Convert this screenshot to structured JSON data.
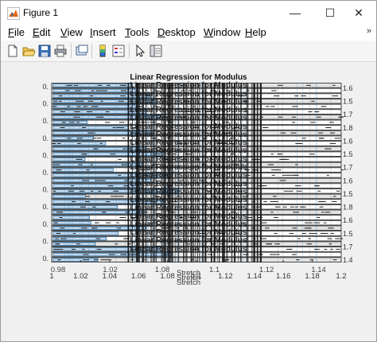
{
  "window": {
    "title": "Figure 1",
    "minimize_glyph": "—",
    "maximize_glyph": "☐",
    "close_glyph": "✕"
  },
  "menubar": {
    "items": [
      {
        "label": "File"
      },
      {
        "label": "Edit"
      },
      {
        "label": "View"
      },
      {
        "label": "Insert"
      },
      {
        "label": "Tools"
      },
      {
        "label": "Desktop"
      },
      {
        "label": "Window"
      },
      {
        "label": "Help"
      }
    ],
    "overflow_glyph": "»"
  },
  "toolbar": {
    "buttons": [
      {
        "icon": "new-figure-icon"
      },
      {
        "icon": "open-file-icon"
      },
      {
        "icon": "save-icon"
      },
      {
        "icon": "print-icon"
      },
      {
        "icon": "link-plot-icon"
      },
      {
        "icon": "insert-colorbar-icon"
      },
      {
        "icon": "insert-legend-icon"
      },
      {
        "icon": "pointer-icon"
      },
      {
        "icon": "property-inspector-icon"
      }
    ]
  },
  "colors": {
    "bar_fill": "#c6dbef",
    "bar_edge": "#1f1f1f",
    "bar_highlight": "#2f6f9f"
  },
  "chart_data": {
    "type": "bar",
    "title": "Linear Regression for Modulus",
    "xlabel": "Stretch",
    "ylabel": "",
    "x_ticks": [
      "1",
      "1.02",
      "1.04",
      "1.06",
      "1.08",
      "1.1",
      "1.12",
      "1.14",
      "1.16",
      "1.18",
      "1.2"
    ],
    "x_ticks_secondary": [
      "0.98",
      "1.02",
      "1.08",
      "1.1",
      "1.12",
      "1.14"
    ],
    "left_tick_labels": [
      "0.",
      "0.",
      "0.",
      "0.",
      "0.",
      "0.",
      "0.",
      "0.",
      "0.",
      "0.",
      "0."
    ],
    "right_tick_labels": [
      "1.6",
      "1.5",
      "1.7",
      "1.8",
      "1.6",
      "1.5",
      "1.7",
      "1.6",
      "1.5",
      "1.8",
      "1.6",
      "1.5",
      "1.7",
      "1.4"
    ],
    "grid": false,
    "legend": "none",
    "note": "Heavily overlapping stacked axes; repeated titles and labels rendered over one another."
  }
}
